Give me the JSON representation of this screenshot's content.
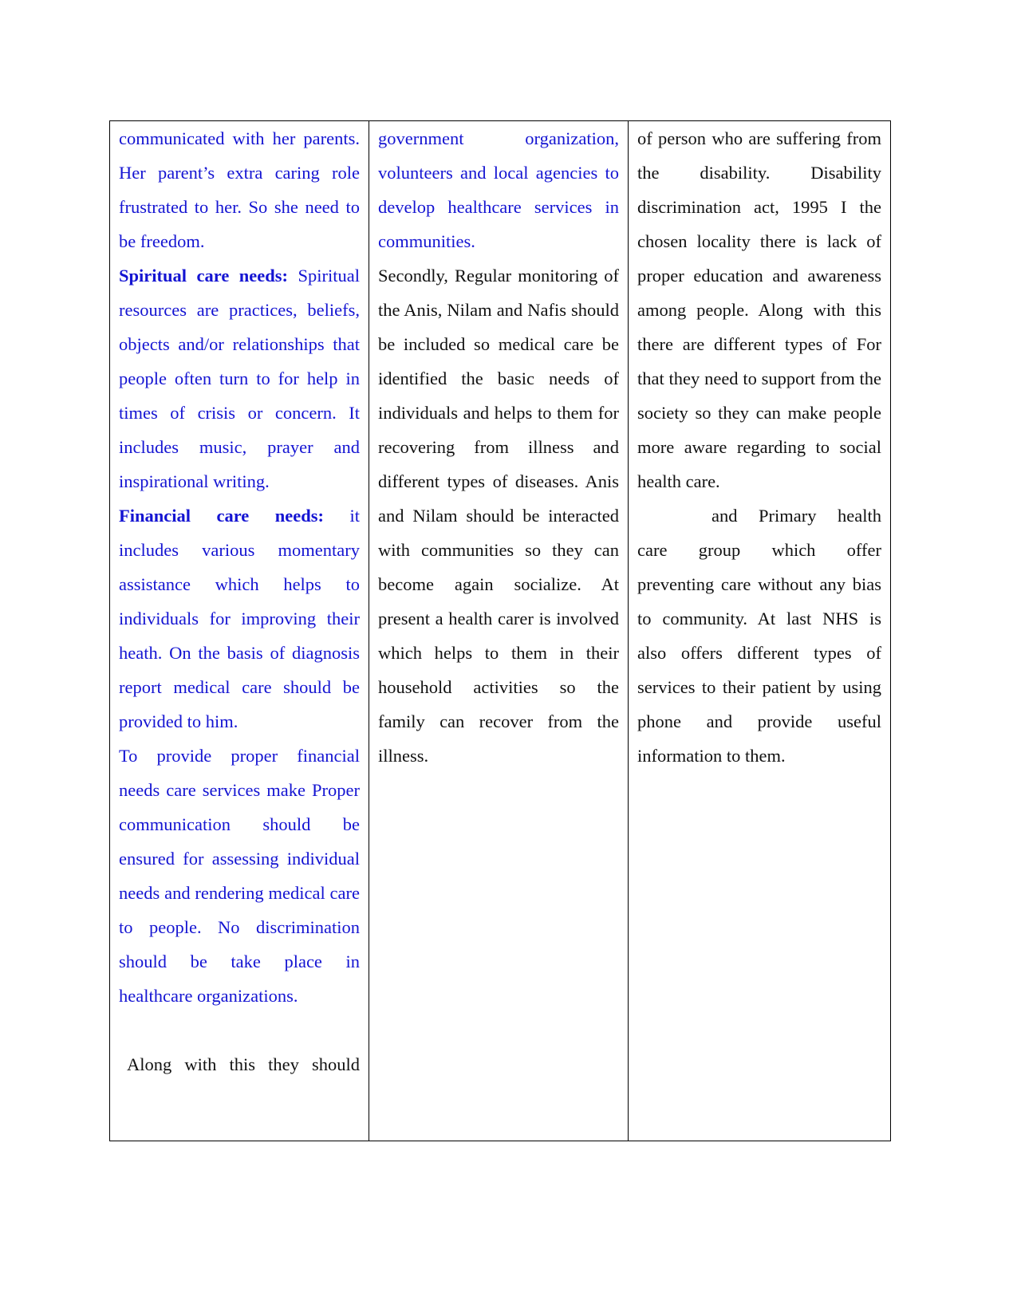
{
  "document": {
    "table": {
      "columns": [
        {
          "paragraphs": [
            {
              "id": "c1p1",
              "color": "blue",
              "heading": "",
              "text": "communicated with her parents. Her parent’s extra caring role frustrated to her. So she need to be freedom."
            },
            {
              "id": "c1p2",
              "color": "blue",
              "heading": "Spiritual care needs:",
              "text": "Spiritual resources are practices, beliefs, objects and/or relationships that people often turn to for help in times of crisis or concern. It  includes music, prayer and inspirational writing."
            },
            {
              "id": "c1p3",
              "color": "blue",
              "heading": "Financial care needs:",
              "text": "it includes various momentary assistance which helps to individuals for improving their heath. On the basis of diagnosis report medical care should be provided to him."
            },
            {
              "id": "c1p4",
              "color": "blue",
              "heading": "",
              "text": "To provide proper financial needs care services make Proper communication should be ensured for assessing individual needs and rendering medical care to people. No discrimination should be take place in healthcare organizations."
            },
            {
              "id": "c1p5",
              "color": "black",
              "heading": "",
              "text": "Along with this they should"
            }
          ]
        },
        {
          "paragraphs": [
            {
              "id": "c2p1",
              "color": "blue",
              "heading": "",
              "text": "government organization, volunteers and local agencies to develop healthcare services in communities."
            },
            {
              "id": "c2p2",
              "color": "black",
              "heading": "",
              "text": "Secondly, Regular monitoring of the Anis, Nilam and Nafis should be included so medical care be identified the basic needs of individuals and helps to them for recovering from illness and different types of diseases. Anis and Nilam should be interacted with communities so  they can become again socialize. At present a health carer is involved which helps to them in their household activities so the family can recover from the illness."
            }
          ]
        },
        {
          "paragraphs": [
            {
              "id": "c3p1",
              "color": "black",
              "heading": "",
              "text": "of person who are suffering from the disability.  Disability discrimination act, 1995  I the chosen locality there is lack of proper education and awareness among people. Along with this there are different types of For that they need to support from the society so they can make people more aware regarding to social health care."
            },
            {
              "id": "c3p2",
              "color": "black",
              "heading": "",
              "text": "and Primary health care group which offer preventing care without any bias to community. At last NHS is also offers different types of services to their patient by using phone and provide useful information to them."
            }
          ]
        }
      ]
    }
  }
}
